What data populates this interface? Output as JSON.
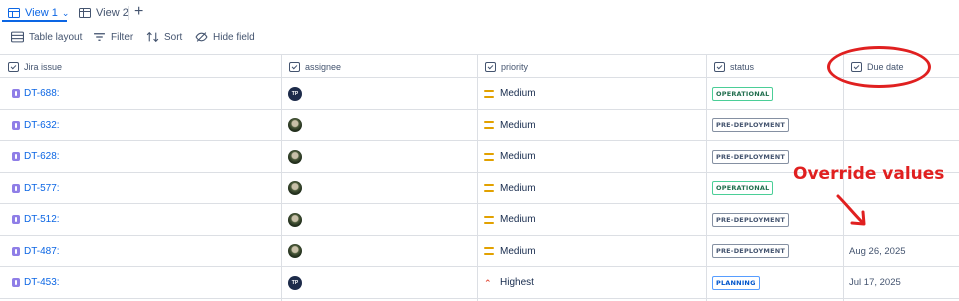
{
  "tabs": [
    {
      "label": "View 1",
      "active": true,
      "icon": "table-view-icon"
    },
    {
      "label": "View 2",
      "active": false,
      "icon": "table-icon"
    }
  ],
  "toolbar": {
    "table_layout": "Table layout",
    "filter": "Filter",
    "sort": "Sort",
    "hide_field": "Hide field"
  },
  "columns": {
    "issue": "Jira issue",
    "assignee": "assignee",
    "priority": "priority",
    "status": "status",
    "due": "Due date"
  },
  "rows": [
    {
      "key": "DT-688:",
      "assignee": "TP",
      "priority": "Medium",
      "status": "OPERATIONAL",
      "due": ""
    },
    {
      "key": "DT-632:",
      "assignee": "",
      "priority": "Medium",
      "status": "PRE-DEPLOYMENT",
      "due": ""
    },
    {
      "key": "DT-628:",
      "assignee": "",
      "priority": "Medium",
      "status": "PRE-DEPLOYMENT",
      "due": ""
    },
    {
      "key": "DT-577:",
      "assignee": "",
      "priority": "Medium",
      "status": "OPERATIONAL",
      "due": ""
    },
    {
      "key": "DT-512:",
      "assignee": "",
      "priority": "Medium",
      "status": "PRE-DEPLOYMENT",
      "due": ""
    },
    {
      "key": "DT-487:",
      "assignee": "",
      "priority": "Medium",
      "status": "PRE-DEPLOYMENT",
      "due": "Aug 26, 2025"
    },
    {
      "key": "DT-453:",
      "assignee": "TP",
      "priority": "Highest",
      "status": "PLANNING",
      "due": "Jul 17, 2025"
    }
  ],
  "annotation": {
    "text": "Override values",
    "color": "#e02020"
  },
  "colors": {
    "accent": "#0c66e4",
    "operational": "#216e4e",
    "planning": "#0055cc",
    "medium_priority": "#e2a100",
    "highest_priority": "#e34935"
  }
}
